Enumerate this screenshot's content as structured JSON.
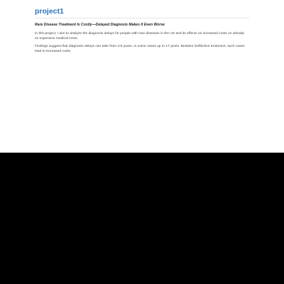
{
  "header": {
    "site_title": "project1",
    "colors": {
      "title": "#2a73b8",
      "background_top": "#ffffff",
      "background_bottom": "#000000"
    }
  },
  "post": {
    "title": "Rare Disease Treatment Is Costly—Delayed Diagnosis Makes It Even Worse",
    "paragraphs": [
      "In this project, I aim to analyze the diagnosis delays for people with rare diseases in the US and its effects on increased costs on already so expensive medical costs.",
      "Findings suggest that diagnosis delays can take from 4-5 years, in some cases up to 17 years. Besides ineffective treatment, such cases lead to increased costs."
    ]
  }
}
